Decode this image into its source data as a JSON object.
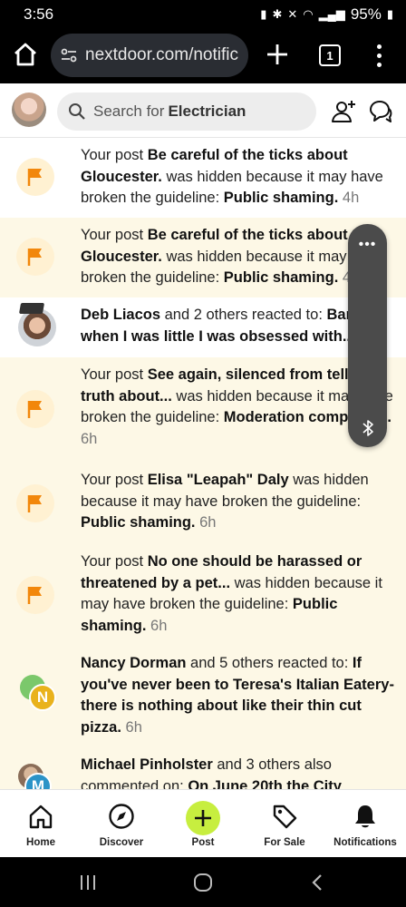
{
  "status_bar": {
    "time": "3:56",
    "battery": "95%"
  },
  "browser": {
    "url": "nextdoor.com/notific",
    "tab_count": "1"
  },
  "header": {
    "search_prefix": "Search for",
    "search_term": "Electrician"
  },
  "notifications": [
    {
      "type": "flag",
      "unread": false,
      "pre": "Your post ",
      "bold1": "Be careful of the ticks about Gloucester.",
      "mid": " was hidden because it may have broken the guideline: ",
      "bold2": "Public shaming.",
      "time": "4h"
    },
    {
      "type": "flag",
      "unread": true,
      "pre": "Your post ",
      "bold1": "Be careful of the ticks about Gloucester.",
      "mid": " was hidden because it may have broken the guideline: ",
      "bold2": "Public shaming.",
      "time": "4h"
    },
    {
      "type": "person",
      "unread": false,
      "bold1": "Deb Liacos",
      "mid": " and 2 others reacted to: ",
      "bold2": "Barn\nwhen I was little I was obsessed with...",
      "time": "5"
    },
    {
      "type": "flag",
      "unread": true,
      "pre": "Your post ",
      "bold1": "See again, silenced from telling truth about...",
      "mid": " was hidden because it may have broken the guideline: ",
      "bold2": "Moderation complaints.",
      "time": "6h"
    },
    {
      "type": "flag",
      "unread": true,
      "pre": "Your post ",
      "bold1": "Elisa \"Leapah\" Daly",
      "mid": " was hidden because it may have broken the guideline: ",
      "bold2": "Public shaming.",
      "time": "6h"
    },
    {
      "type": "flag",
      "unread": true,
      "pre": "Your post ",
      "bold1": "No one should be harassed or threatened by a pet...",
      "mid": " was hidden because it may have broken the guideline: ",
      "bold2": "Public shaming.",
      "time": "6h"
    },
    {
      "type": "letter",
      "unread": true,
      "letter": "N",
      "bold1": "Nancy Dorman",
      "mid": " and 5 others reacted to: ",
      "bold2": "If you've never been to Teresa's Italian Eatery- there is nothing about like their thin cut pizza.",
      "time": "6h"
    },
    {
      "type": "letter",
      "unread": true,
      "letter": "M",
      "bold1": "Michael Pinholster",
      "mid": " and 3 others also commented on: ",
      "bold2": "On June 20th the City",
      "time": ""
    }
  ],
  "bottom_nav": [
    {
      "label": "Home",
      "icon": "home-icon"
    },
    {
      "label": "Discover",
      "icon": "compass-icon"
    },
    {
      "label": "Post",
      "icon": "plus-icon"
    },
    {
      "label": "For Sale",
      "icon": "price-tag-icon"
    },
    {
      "label": "Notifications",
      "icon": "bell-icon"
    }
  ],
  "colors": {
    "unread_bg": "#fdf8e6",
    "flag": "#f2870b",
    "post_button": "#c7ee3f",
    "letter_n": "#e9b21c",
    "letter_m": "#2b93c7"
  }
}
